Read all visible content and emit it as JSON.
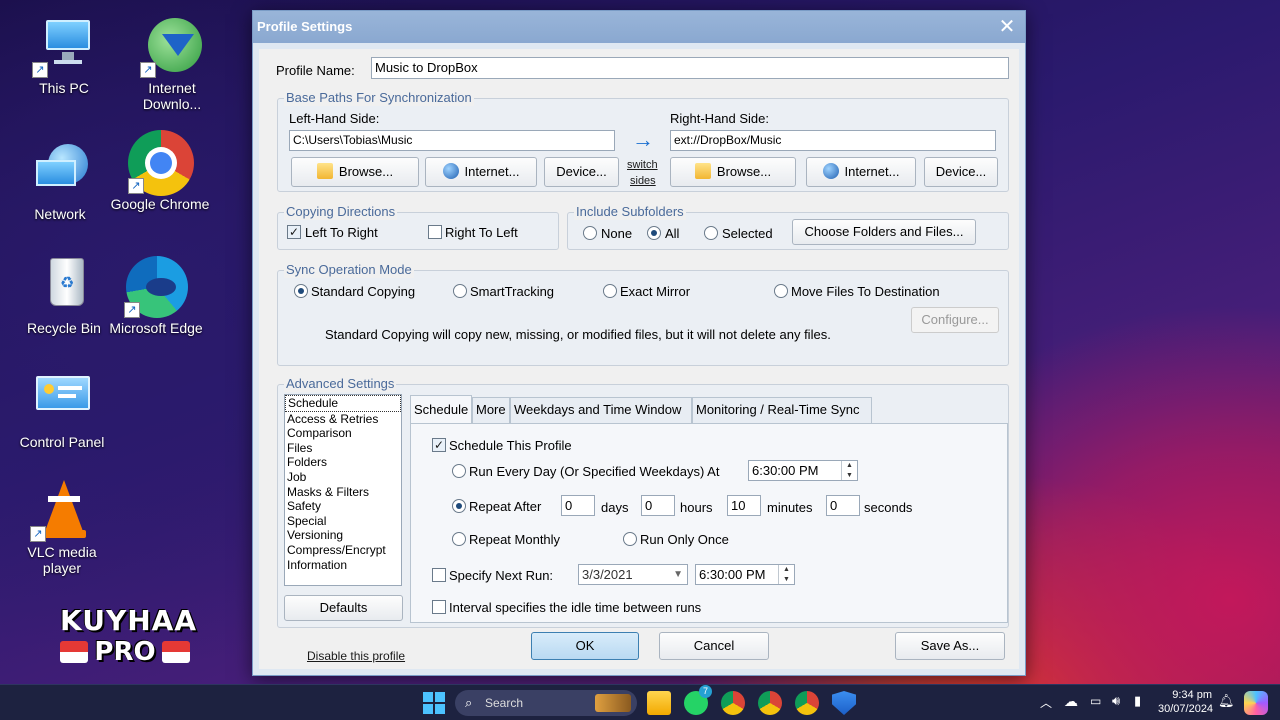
{
  "desktop": {
    "icons": [
      {
        "label": "This PC",
        "icon": "computer-icon"
      },
      {
        "label": "Internet Downlo...",
        "icon": "download-manager-icon"
      },
      {
        "label": "Network",
        "icon": "network-icon"
      },
      {
        "label": "Google Chrome",
        "icon": "chrome-icon"
      },
      {
        "label": "Recycle Bin",
        "icon": "recycle-bin-icon"
      },
      {
        "label": "Microsoft Edge",
        "icon": "edge-icon"
      },
      {
        "label": "Control Panel",
        "icon": "control-panel-icon"
      },
      {
        "label": "VLC media player",
        "icon": "vlc-icon"
      }
    ],
    "watermark": {
      "line1": "KUYHAA",
      "line2": "PRO"
    }
  },
  "dialog": {
    "title": "Profile Settings",
    "profile_name_label": "Profile Name:",
    "profile_name_value": "Music to DropBox",
    "base_paths": {
      "title": "Base Paths For Synchronization",
      "left_label": "Left-Hand Side:",
      "left_value": "C:\\Users\\Tobias\\Music",
      "right_label": "Right-Hand Side:",
      "right_value": "ext://DropBox/Music",
      "browse": "Browse...",
      "internet": "Internet...",
      "device": "Device...",
      "switch_line1": "switch",
      "switch_line2": "sides"
    },
    "copying_directions": {
      "title": "Copying Directions",
      "left_to_right": "Left To Right",
      "right_to_left": "Right To Left",
      "left_to_right_checked": true,
      "right_to_left_checked": false
    },
    "include_subfolders": {
      "title": "Include Subfolders",
      "none": "None",
      "all": "All",
      "selected": "Selected",
      "choose_button": "Choose Folders and Files...",
      "current": "All"
    },
    "sync_mode": {
      "title": "Sync Operation Mode",
      "options": [
        "Standard Copying",
        "SmartTracking",
        "Exact Mirror",
        "Move Files To Destination"
      ],
      "current": "Standard Copying",
      "configure": "Configure...",
      "description": "Standard Copying will copy new, missing, or modified files, but it will not delete any files."
    },
    "advanced": {
      "title": "Advanced Settings",
      "list": [
        "Schedule",
        "Access & Retries",
        "Comparison",
        "Files",
        "Folders",
        "Job",
        "Masks & Filters",
        "Safety",
        "Special",
        "Versioning",
        "Compress/Encrypt",
        "Information"
      ],
      "selected": "Schedule",
      "defaults_button": "Defaults",
      "tabs": [
        "Schedule",
        "More",
        "Weekdays and Time Window",
        "Monitoring / Real-Time Sync"
      ],
      "active_tab": "Schedule",
      "schedule": {
        "schedule_this_profile": "Schedule This Profile",
        "schedule_checked": true,
        "run_every_day": "Run Every Day (Or Specified Weekdays) At",
        "run_every_day_time": "6:30:00 PM",
        "repeat_after": "Repeat After",
        "days_value": "0",
        "days_label": "days",
        "hours_value": "0",
        "hours_label": "hours",
        "minutes_value": "10",
        "minutes_label": "minutes",
        "seconds_value": "0",
        "seconds_label": "seconds",
        "repeat_monthly": "Repeat Monthly",
        "run_only_once": "Run Only Once",
        "current_mode": "Repeat After",
        "specify_next_run": "Specify Next Run:",
        "specify_next_run_checked": false,
        "next_run_date": "3/3/2021",
        "next_run_time": "6:30:00 PM",
        "interval_idle": "Interval specifies the idle time between runs",
        "interval_idle_checked": false
      }
    },
    "footer": {
      "disable_link": "Disable this profile",
      "ok": "OK",
      "cancel": "Cancel",
      "save_as": "Save As..."
    }
  },
  "taskbar": {
    "search_placeholder": "Search",
    "whatsapp_badge": "7",
    "time": "9:34 pm",
    "date": "30/07/2024"
  }
}
